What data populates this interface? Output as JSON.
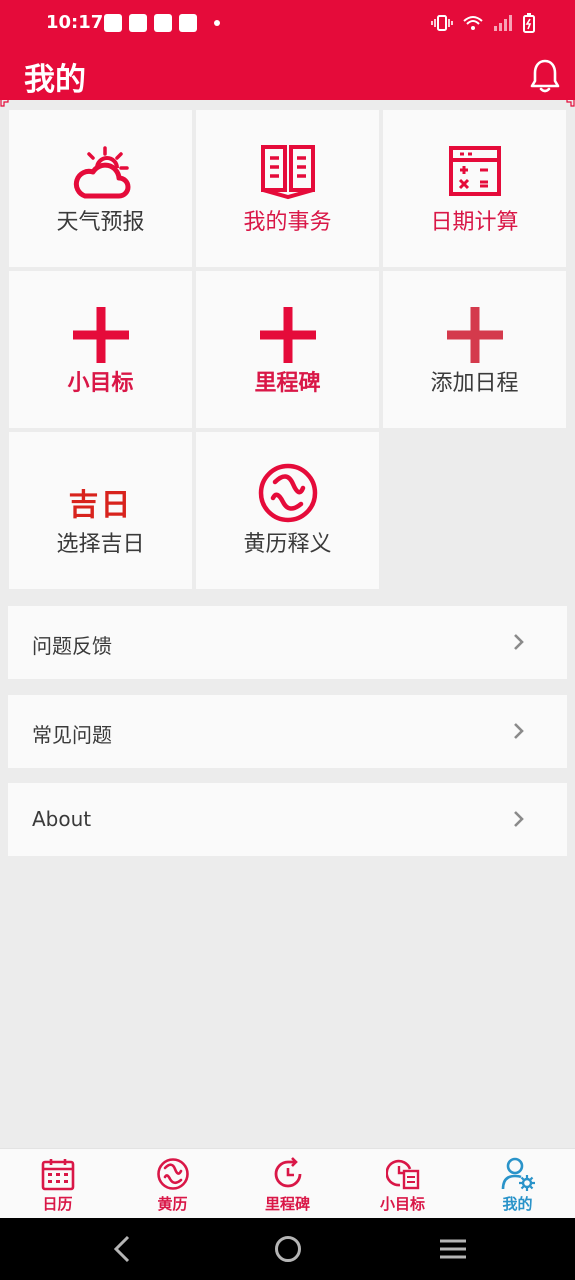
{
  "status_bar": {
    "time": "10:17"
  },
  "header": {
    "title": "我的"
  },
  "grid": {
    "items": [
      {
        "label": "天气预报",
        "icon": "weather-cloud-sun-icon"
      },
      {
        "label": "我的事务",
        "icon": "book-icon"
      },
      {
        "label": "日期计算",
        "icon": "calculator-icon"
      },
      {
        "label": "小目标",
        "icon": "plus-icon"
      },
      {
        "label": "里程碑",
        "icon": "plus-icon"
      },
      {
        "label": "添加日程",
        "icon": "plus-icon"
      },
      {
        "label": "选择吉日",
        "icon_text": "吉日"
      },
      {
        "label": "黄历释义",
        "icon": "yin-yang-icon"
      }
    ]
  },
  "menu": {
    "items": [
      {
        "label": "问题反馈"
      },
      {
        "label": "常见问题"
      },
      {
        "label": "About"
      }
    ]
  },
  "tabs": {
    "items": [
      {
        "label": "日历",
        "icon": "calendar-icon"
      },
      {
        "label": "黄历",
        "icon": "yin-yang-icon"
      },
      {
        "label": "里程碑",
        "icon": "clock-refresh-icon"
      },
      {
        "label": "小目标",
        "icon": "goal-calendar-icon"
      },
      {
        "label": "我的",
        "icon": "user-settings-icon",
        "active": true
      }
    ]
  },
  "colors": {
    "brand_red": "#e50b3a",
    "label_red": "#d91747",
    "active_tab_blue": "#2a93c9",
    "background": "#ececec"
  }
}
